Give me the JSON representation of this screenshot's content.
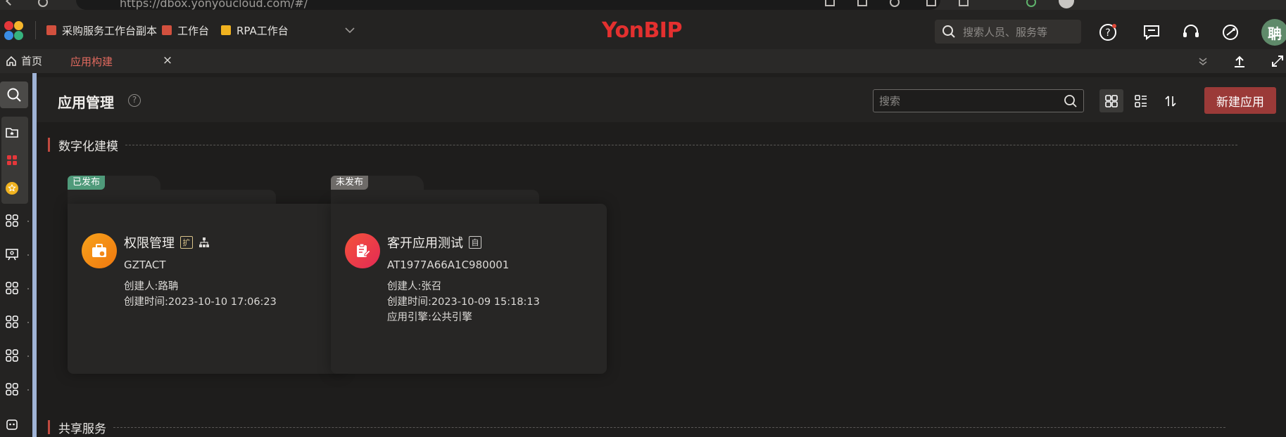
{
  "browser": {
    "url": "https://dbox.yonyoucloud.com/#/"
  },
  "topbar": {
    "workbenches": [
      {
        "label": "采购服务工作台副本",
        "icon": "workbench-icon",
        "color": "#e0533f"
      },
      {
        "label": "工作台",
        "icon": "workbench-icon",
        "color": "#e0533f"
      },
      {
        "label": "RPA工作台",
        "icon": "rpa-icon",
        "color": "#f0b21f"
      }
    ],
    "brand": "YonBIP",
    "search_placeholder": "搜索人员、服务等",
    "avatar_text": "聃"
  },
  "tabs": {
    "home_label": "首页",
    "active_label": "应用构建",
    "close_symbol": "×"
  },
  "page": {
    "title": "应用管理",
    "help_symbol": "?",
    "search_placeholder": "搜索",
    "new_button": "新建应用"
  },
  "sections": [
    {
      "label": "数字化建模"
    },
    {
      "label": "共享服务"
    }
  ],
  "apps": [
    {
      "status": "已发布",
      "status_color": "#4f9a7a",
      "name": "权限管理",
      "tag": "扩",
      "code": "GZTACT",
      "creator": "创建人:路聃",
      "created_at": "创建时间:2023-10-10 17:06:23",
      "engine": "",
      "icon_gradient": [
        "#f7a21b",
        "#f0780f"
      ]
    },
    {
      "status": "未发布",
      "status_color": "#6e6b68",
      "name": "客开应用测试",
      "tag": "自",
      "code": "AT1977A66A1C980001",
      "creator": "创建人:张召",
      "created_at": "创建时间:2023-10-09 15:18:13",
      "engine": "应用引擎:公共引擎",
      "icon_gradient": [
        "#f4523a",
        "#e42a55"
      ]
    }
  ]
}
